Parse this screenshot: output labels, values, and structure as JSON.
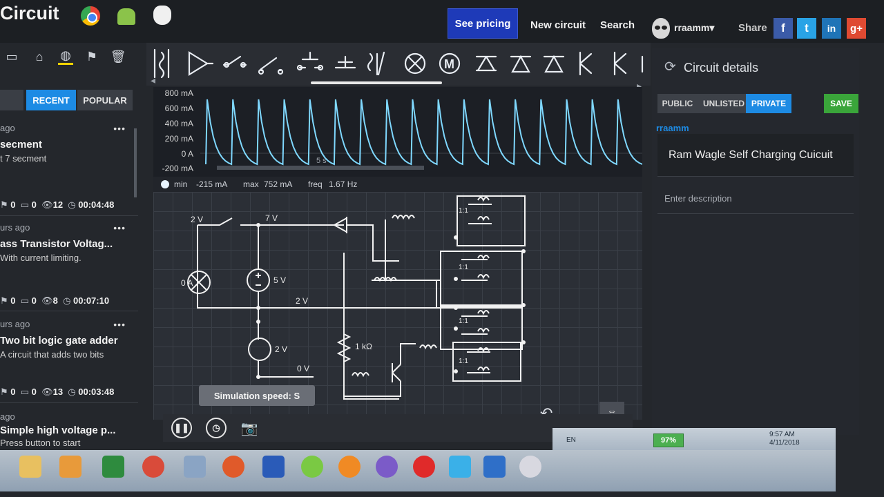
{
  "app": {
    "brand": "Circuit"
  },
  "header": {
    "pricing_label": "See pricing",
    "new_circuit_label": "New circuit",
    "search_label": "Search",
    "user_name": "rraamm",
    "user_caret": "▾",
    "share_label": "Share",
    "social": [
      {
        "icon": "facebook-icon",
        "glyph": "f",
        "color": "#3b5ba8"
      },
      {
        "icon": "twitter-icon",
        "glyph": "t",
        "color": "#29a3e6"
      },
      {
        "icon": "linkedin-icon",
        "glyph": "in",
        "color": "#1f74b7"
      },
      {
        "icon": "google-plus-icon",
        "glyph": "g+",
        "color": "#df4a32"
      }
    ]
  },
  "sidebar": {
    "tab_recent": "RECENT",
    "tab_popular": "POPULAR",
    "items": [
      {
        "time": "ago",
        "title": "secment",
        "desc": "t 7 secment",
        "saves": "0",
        "comments": "0",
        "views": "12",
        "duration": "00:04:48"
      },
      {
        "time": "urs ago",
        "title": "ass Transistor Voltag...",
        "desc": "With current limiting.",
        "saves": "0",
        "comments": "0",
        "views": "8",
        "duration": "00:07:10"
      },
      {
        "time": "urs ago",
        "title": "Two bit logic gate adder",
        "desc": "A circuit that adds two bits",
        "saves": "0",
        "comments": "0",
        "views": "13",
        "duration": "00:03:48"
      },
      {
        "time": "ago",
        "title": "Simple high voltage p...",
        "desc": "Press button to start"
      }
    ]
  },
  "scope": {
    "labels": [
      "800 mA",
      "600 mA",
      "400 mA",
      "200 mA",
      "0 A",
      "-200 mA"
    ],
    "time_label": "5 s",
    "min_label": "min",
    "min_value": "-215 mA",
    "max_label": "max",
    "max_value": "752 mA",
    "freq_label": "freq",
    "freq_value": "1.67 Hz"
  },
  "schematic": {
    "labels": [
      "2 V",
      "7 V",
      "0 A",
      "5 V",
      "2 V",
      "2 V",
      "0 V",
      "1 kΩ",
      "1:1",
      "1:1",
      "1:1",
      "1:1"
    ]
  },
  "canvas": {
    "sim_speed": "Simulation speed: S"
  },
  "details": {
    "title": "Circuit details",
    "vis_public": "PUBLIC",
    "vis_unlisted": "UNLISTED",
    "vis_private": "PRIVATE",
    "save_label": "SAVE",
    "author": "rraamm",
    "circuit_name": "Ram Wagle Self Charging Cuicuit",
    "desc_placeholder": "Enter description"
  },
  "tray": {
    "lang": "EN",
    "battery": "97%",
    "time": "9:57 AM",
    "date": "4/11/2018"
  },
  "colors": {
    "accent": "#1d8be4",
    "save": "#3aa53a",
    "pricing": "#1e3ab8",
    "trace": "#7fd8ff"
  }
}
